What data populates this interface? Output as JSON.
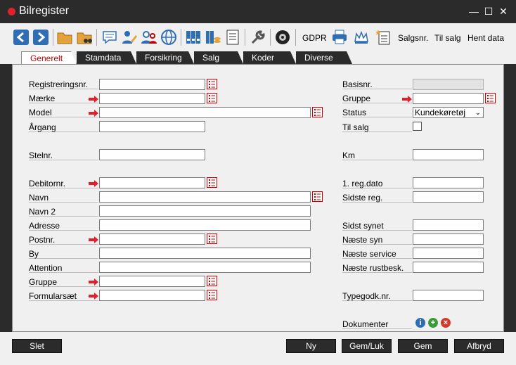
{
  "window": {
    "title": "Bilregister",
    "minimize": "—",
    "maximize": "☐",
    "close": "✕"
  },
  "toolbar": {
    "gdpr": "GDPR",
    "salgsnr": "Salgsnr.",
    "til_salg": "Til salg",
    "hent_data": "Hent data"
  },
  "tabs": [
    {
      "label": "Generelt"
    },
    {
      "label": "Stamdata"
    },
    {
      "label": "Forsikring"
    },
    {
      "label": "Salg"
    },
    {
      "label": "Koder"
    },
    {
      "label": "Diverse"
    }
  ],
  "left_fields": {
    "registreringsnr": "Registreringsnr.",
    "maerke": "Mærke",
    "model": "Model",
    "aargang": "Årgang",
    "stelnr": "Stelnr.",
    "debitornr": "Debitornr.",
    "navn": "Navn",
    "navn2": "Navn 2",
    "adresse": "Adresse",
    "postnr": "Postnr.",
    "by": "By",
    "attention": "Attention",
    "gruppe": "Gruppe",
    "formularsaet": "Formularsæt"
  },
  "right_fields": {
    "basisnr": "Basisnr.",
    "gruppe": "Gruppe",
    "status": "Status",
    "status_value": "Kundekøretøj",
    "til_salg": "Til salg",
    "km": "Km",
    "reg_dato": "1. reg.dato",
    "sidste_reg": "Sidste reg.",
    "sidst_synet": "Sidst synet",
    "naeste_syn": "Næste syn",
    "naeste_service": "Næste service",
    "naeste_rustbesk": "Næste rustbesk.",
    "typegodk": "Typegodk.nr.",
    "dokumenter": "Dokumenter"
  },
  "buttons": {
    "slet": "Slet",
    "ny": "Ny",
    "gem_luk": "Gem/Luk",
    "gem": "Gem",
    "afbryd": "Afbryd"
  },
  "colors": {
    "accent_red": "#e0202a",
    "dark": "#2b2b2b",
    "toolbar_blue": "#2f6db5"
  }
}
